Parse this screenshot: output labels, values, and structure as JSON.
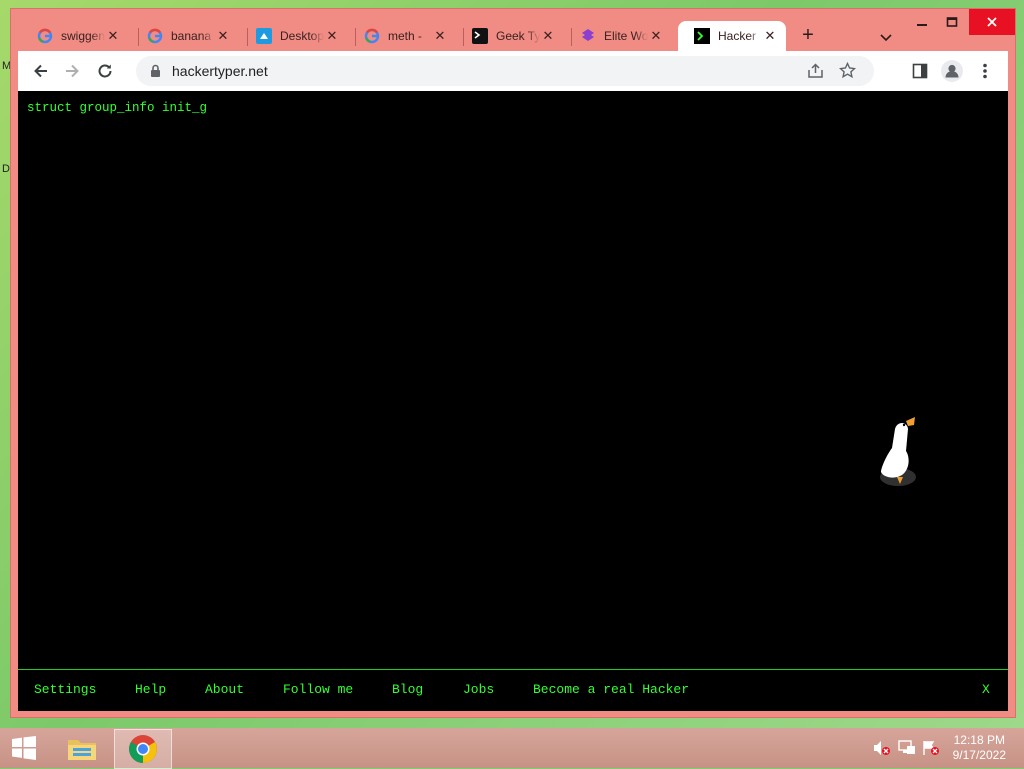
{
  "desktop": {
    "edge_letters": [
      "M",
      "D"
    ]
  },
  "browser": {
    "tabs": [
      {
        "title": "swiggen",
        "icon": "google-g-icon",
        "close": "✕"
      },
      {
        "title": "banana",
        "icon": "google-g-icon",
        "close": "✕"
      },
      {
        "title": "Desktop",
        "icon": "desktop-app-icon",
        "close": "✕"
      },
      {
        "title": "meth - ",
        "icon": "google-g-icon",
        "close": "✕"
      },
      {
        "title": "Geek Ty",
        "icon": "terminal-icon",
        "close": "✕"
      },
      {
        "title": "Elite Wo",
        "icon": "elite-logo-icon",
        "close": "✕"
      },
      {
        "title": "Hacker ",
        "icon": "terminal-green-icon",
        "close": "✕",
        "active": true
      }
    ],
    "new_tab": "+",
    "address_bar": {
      "url": "hackertyper.net"
    },
    "colors": {
      "frame": "#f08c84",
      "close_button": "#e81123"
    }
  },
  "page": {
    "typed_code": "struct group_info init_g",
    "text_color": "#33ff33",
    "background": "#000000",
    "footer_links": [
      "Settings",
      "Help",
      "About",
      "Follow me",
      "Blog",
      "Jobs",
      "Become a real Hacker"
    ],
    "footer_close": "X"
  },
  "taskbar": {
    "clock_time": "12:18 PM",
    "clock_date": "9/17/2022"
  }
}
